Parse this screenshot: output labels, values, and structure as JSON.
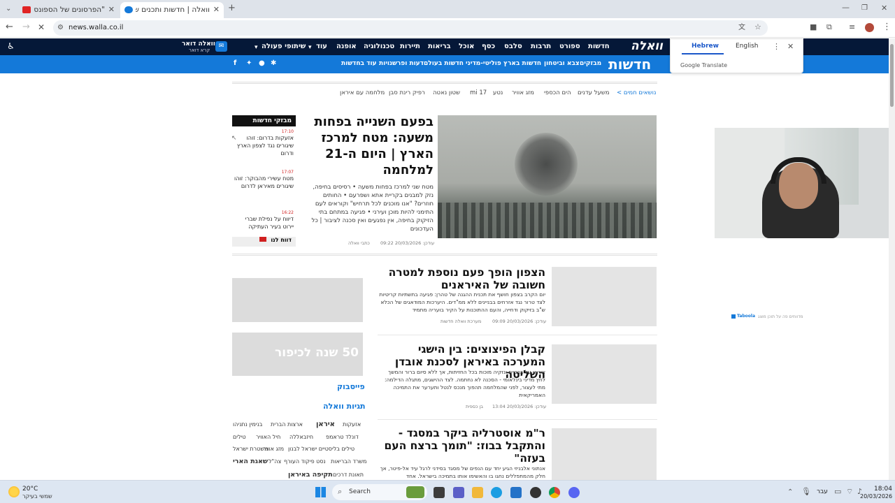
{
  "browser": {
    "tabs": [
      {
        "title": "\"הפרסונים של הספונסר שעשתי",
        "active": false
      },
      {
        "title": "וואלה | חדשות ותכנים שעוסקים",
        "active": true
      }
    ],
    "url": "news.walla.co.il"
  },
  "topnav": {
    "logo": "וואלה",
    "items": [
      "חדשות",
      "ספורט",
      "תרבות",
      "סלבס",
      "כסף",
      "אוכל",
      "בריאות",
      "תיירות",
      "טכנולוגיה",
      "אופנה",
      "עוד",
      "שיתופי פעולה"
    ],
    "mail_label": "וואלה דואר",
    "mail_sub": "קרא דואר"
  },
  "bluenav": {
    "section_title": "חדשות",
    "items": [
      "מבזקים",
      "צבא וביטחון",
      "חדשות בארץ",
      "פוליטי-מדיני",
      "חדשות בעולם",
      "דעות ופרשנויות",
      "עוד בחדשות"
    ]
  },
  "translate": {
    "lang1": "Hebrew",
    "lang2": "English",
    "brand": "Google Translate"
  },
  "hot_topics": {
    "label": "נושאים חמים >",
    "items": [
      "משעל עדנים",
      "הים הכספי",
      "מזג אוויר",
      "נטע",
      "17 mi",
      "שטון נאטה",
      "רפיק רינת סבן",
      "מלחמה עם איראן"
    ]
  },
  "main_story": {
    "title": "בפעם השנייה בפחות משעה: מטח למרכז הארץ | היום ה-21 למלחמה",
    "summary": "מטח שני למרכז בפחות משעה • רסיסים בחיפה, נזק למבנים בקריית אתא ושפרעם • החותים חוזרים? \"אנו מוכנים לכל תרחיש\" וקוראים לעם התימני להיות מוכן ועירני • פגיעה במתחם בתי הזיקוק בחיפה, אין נפגעים ואין סכנה לציבור | כל העדכונים",
    "date": "עודכן: 20/03/2026 09:22",
    "author": "כתבי וואלה"
  },
  "flash": {
    "title": "מבזקי חדשות",
    "items": [
      {
        "time": "17:10",
        "text": "אזעקות בדרום: זוהו שיגורים נגד לצפון הארץ ודרום"
      },
      {
        "time": "17:07",
        "text": "מטח עשירי מהבוקר: זוהו שיגורים מאיראן לדרום"
      },
      {
        "time": "16:22",
        "text": "דיווח על נפילת שברי יירוט בעיר העתיקה"
      }
    ],
    "footer": "דווח לנו"
  },
  "articles": [
    {
      "title": "הצפון הופך פעם נוספת למטרה חשובה של האיראנים",
      "summary": "יום הקרב בצפון חושף את תכנית ההגנה של טהרן: פגיעה בתשתיות קריטיות לצד טרור נגד אזרחים בבניינים ללא ממ\"דים. היערכות המודאגים של הכלא ש\"ב בזיקוק ודחייה, והעם ההתוכנות על הקיר בועריה מתמיד",
      "date": "עודכן: 20/03/2026 09:09",
      "author": "מערכת וואלה חדשות"
    },
    {
      "title": "קבלן הפיצוצים: בין הישגי המערכה באיראן לסכנת אובדן השליטה",
      "summary": "איראן על ברכיים ונזקיה מוכות בכל החזיתות, אך ללא סיום ברור והמשך לחץ מדיני בינלאומי - הסכנה לא נחתמה. לצד ההישגים, מתגלה הדילמה: מתי לעצור, לפני שהמלחמה תהפוך מנכס לנטל ותערער את התמיכה האמריקאית",
      "date": "עודכן: 20/03/2026 13:04",
      "author": "בן כספית"
    },
    {
      "title": "ר\"מ אוסטרליה ביקר במסגד - והתקבל בבוז: \"תומך ברצח העם בעזה\"",
      "summary": "אנתוני אלבניזי הגיע יחד עם הנפים של מסגד בסידני לרגל עיד אל-פיטר, אך חלק מהמתפללים נחגו בו והאשימו אותו בתמיכה בישראל. אחד",
      "date": "",
      "author": ""
    }
  ],
  "sidebar": {
    "promo": "50 שנה לכיפור",
    "facebook": "פייסבוק",
    "tags_title": "תגיות וואלה",
    "tags": [
      "אזעקות",
      "איראן",
      "ארצות הברית",
      "בנימין נתניהו",
      "דונלד טראמפ",
      "חיזבאללה",
      "חיל האוויר",
      "טילים",
      "טילים בליסטיים ישראל לבנון",
      "מזג אוויר",
      "משטרת ישראל",
      "משרד הבריאות",
      "נסט פיקוד העורף",
      "צה\"ל",
      "שאגת הארי",
      "תאונת דרכים",
      "תקיפה באיראן"
    ]
  },
  "ad_label": "מדווחים פה על תוכן מוצג",
  "ad_brand": "Taboola",
  "taskbar": {
    "weather_temp": "20°C",
    "weather_desc": "שמשי בעיקר",
    "search": "Search",
    "lang": "עבר",
    "time": "18:04",
    "date": "20/03/2026"
  }
}
